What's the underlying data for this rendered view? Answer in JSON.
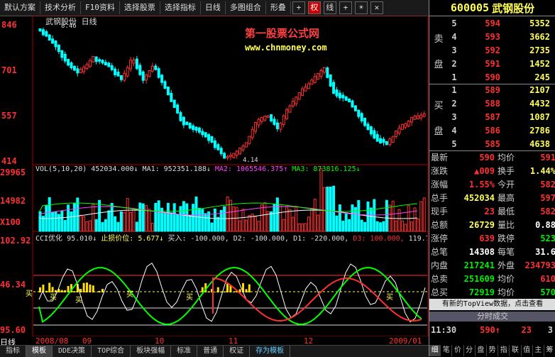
{
  "toolbar": {
    "buttons": [
      "默认方案",
      "技术分析",
      "F10资料",
      "选择股票",
      "选择指标",
      "日线",
      "多图组合",
      "形叠"
    ],
    "icons": [
      "plus-icon",
      "quan-icon",
      "xian-icon",
      "ce-icon",
      "sheng-icon",
      "close-icon"
    ],
    "icon_labels": [
      "+",
      "权",
      "线",
      "+",
      "☀",
      "✕"
    ]
  },
  "chart": {
    "title": "武钢股份 日线",
    "watermark_title": "第一股票公式网",
    "watermark_url": "www.chnmoney.com",
    "high_mark": "8.46",
    "low_mark": "4.14",
    "price_axis": [
      "846",
      "701",
      "557",
      "414"
    ],
    "vol_axis": [
      "29965",
      "14982",
      "X100"
    ],
    "ind_axis": [
      "102.92",
      "46.34",
      "95.60"
    ],
    "vol_legend": {
      "label": "VOL(5,10,20)",
      "vol": "452034.000↓",
      "ma1": "MA1: 952351.188↓",
      "ma2": "MA2: 1065546.375↑",
      "ma3": "MA3: 873816.125↓"
    },
    "ind_legend": {
      "label": "CCI优化",
      "val": "95.010↓",
      "stop": "止损价位: 5.677↓",
      "buy": "买入: -100.000,",
      "d2": "D2: -100.000,",
      "d1": "D1: -220.000,",
      "d3": "D3: 100.000,",
      "v5": "119.768↑,"
    },
    "buy_sell_marks": [
      "买",
      "买",
      "买",
      "买",
      "买",
      "买"
    ],
    "dates": [
      "2008/08",
      "09",
      "10",
      "11",
      "12",
      "2009/01"
    ],
    "period_label": "日线"
  },
  "bottom_tabs": [
    "指标",
    "模板",
    "DDE决策",
    "TOP综合",
    "板块强幅",
    "标准",
    "普通",
    "权证",
    "存为模板"
  ],
  "stock": {
    "code": "600005",
    "name": "武钢股份"
  },
  "order_book": {
    "sell_label": [
      "卖",
      "盘"
    ],
    "buy_label": [
      "买",
      "盘"
    ],
    "sell": [
      {
        "idx": "5",
        "price": "594",
        "vol": "5352"
      },
      {
        "idx": "4",
        "price": "593",
        "vol": "3662"
      },
      {
        "idx": "3",
        "price": "592",
        "vol": "2735"
      },
      {
        "idx": "2",
        "price": "591",
        "vol": "1452"
      },
      {
        "idx": "1",
        "price": "590",
        "vol": "245"
      }
    ],
    "buy": [
      {
        "idx": "1",
        "price": "589",
        "vol": "2107"
      },
      {
        "idx": "2",
        "price": "588",
        "vol": "4432"
      },
      {
        "idx": "3",
        "price": "587",
        "vol": "1087"
      },
      {
        "idx": "4",
        "price": "586",
        "vol": "2786"
      },
      {
        "idx": "5",
        "price": "585",
        "vol": "4638"
      }
    ]
  },
  "quote": [
    {
      "l1": "最新",
      "v1": "590",
      "c1": "red",
      "l2": "均价",
      "v2": "591",
      "c2": "red"
    },
    {
      "l1": "涨跌",
      "v1": "▲009",
      "c1": "red",
      "l2": "换手",
      "v2": "1.44%",
      "c2": "yel"
    },
    {
      "l1": "涨幅",
      "v1": "1.55%",
      "c1": "red",
      "l2": "今开",
      "v2": "582",
      "c2": "red"
    },
    {
      "l1": "总手",
      "v1": "452034",
      "c1": "yel",
      "l2": "最高",
      "v2": "597",
      "c2": "red"
    },
    {
      "l1": "现手",
      "v1": "23",
      "c1": "red",
      "l2": "最低",
      "v2": "582",
      "c2": "red"
    },
    {
      "l1": "总额",
      "v1": "26729",
      "c1": "yel",
      "l2": "量比",
      "v2": "0.88",
      "c2": "wht"
    },
    {
      "l1": "涨停",
      "v1": "639",
      "c1": "red",
      "l2": "跌停",
      "v2": "523",
      "c2": "green"
    },
    {
      "l1": "总笔",
      "v1": "14308",
      "c1": "wht",
      "l2": "每笔",
      "v2": "31.6",
      "c2": "wht"
    },
    {
      "l1": "内盘",
      "v1": "217241",
      "c1": "green",
      "l2": "外盘",
      "v2": "234793",
      "c2": "red"
    },
    {
      "l1": "总卖",
      "v1": "251609",
      "c1": "green",
      "l2": "均价",
      "v2": "610",
      "c2": "red"
    },
    {
      "l1": "总买",
      "v1": "72919",
      "c1": "green",
      "l2": "均价",
      "v2": "570",
      "c2": "green"
    }
  ],
  "topview_text": "有新的TopView数据，点击查看",
  "fsc_label": "分时成交",
  "last_trade": {
    "time": "11:30",
    "price": "590↑",
    "vol": "23",
    "count": "3"
  },
  "right_tabs": [
    "细",
    "笔",
    "价",
    "分",
    "盘",
    "势",
    "指",
    "联",
    "值",
    "主",
    "筹"
  ],
  "colors": {
    "up": "#ff3030",
    "down": "#00ffff",
    "bg": "#000000",
    "accent": "#ffff55"
  }
}
